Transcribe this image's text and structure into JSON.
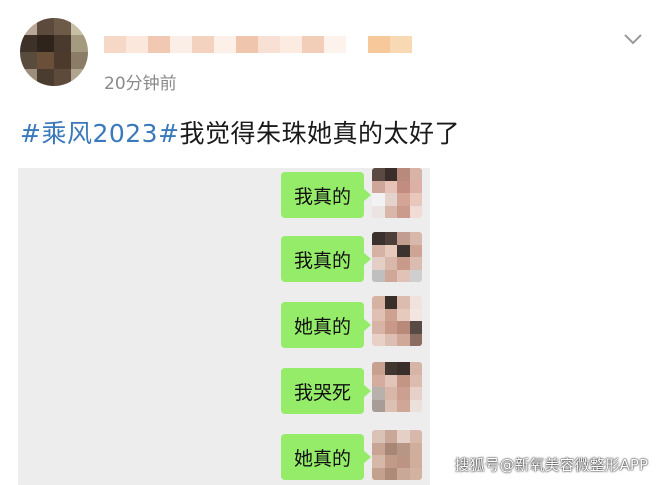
{
  "post": {
    "timestamp": "20分钟前",
    "hashtag": "#乘风2023#",
    "text": "我觉得朱珠她真的太好了",
    "more_icon": "chevron-down-icon"
  },
  "chat": {
    "messages": [
      {
        "text": "我真的"
      },
      {
        "text": "我真的"
      },
      {
        "text": "她真的"
      },
      {
        "text": "我哭死"
      },
      {
        "text": "她真的"
      }
    ]
  },
  "watermark": "搜狐号@新氧美容微整形APP",
  "colors": {
    "hashtag": "#3a79ba",
    "bubble": "#95ec69",
    "chat_bg": "#ededed",
    "timestamp": "#8a8a8a"
  }
}
